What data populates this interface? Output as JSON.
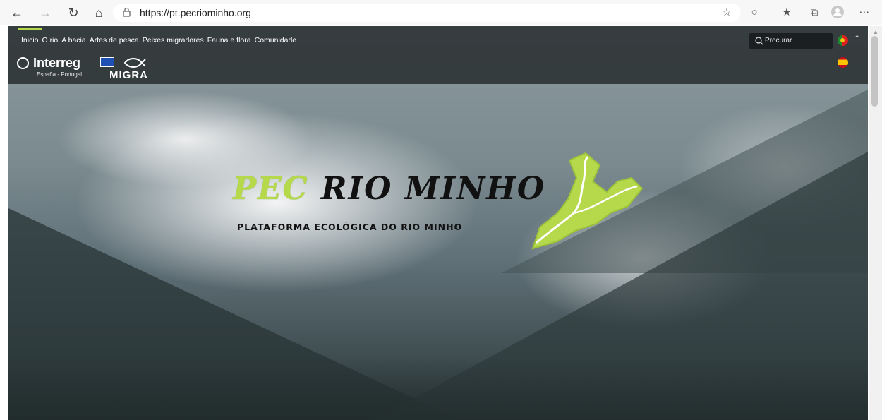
{
  "browser": {
    "url": "https://pt.pecriominho.org",
    "back_icon": "arrow-left-icon",
    "forward_icon": "arrow-right-icon",
    "refresh_icon": "refresh-icon",
    "home_icon": "home-icon",
    "toolbar_icons": [
      "add-favorite-icon",
      "tracking-icon",
      "favorites-icon",
      "collections-icon",
      "profile-icon",
      "more-icon"
    ]
  },
  "site": {
    "menu": [
      "Inicio",
      "O rio",
      "A bacia",
      "Artes de pesca",
      "Peixes migradores",
      "Fauna e flora",
      "Comunidade"
    ],
    "search_placeholder": "Procurar",
    "languages": [
      "pt",
      "es"
    ],
    "accent_color": "#b5d94b",
    "logos": {
      "interreg_title": "Interreg",
      "interreg_subtitle": "España - Portugal",
      "migra_title": "MIGRA"
    },
    "hero": {
      "title_prefix": "PEC",
      "title_rest": "RIO MINHO",
      "subtitle": "PLATAFORMA ECOLÓGICA DO RIO MINHO"
    }
  }
}
